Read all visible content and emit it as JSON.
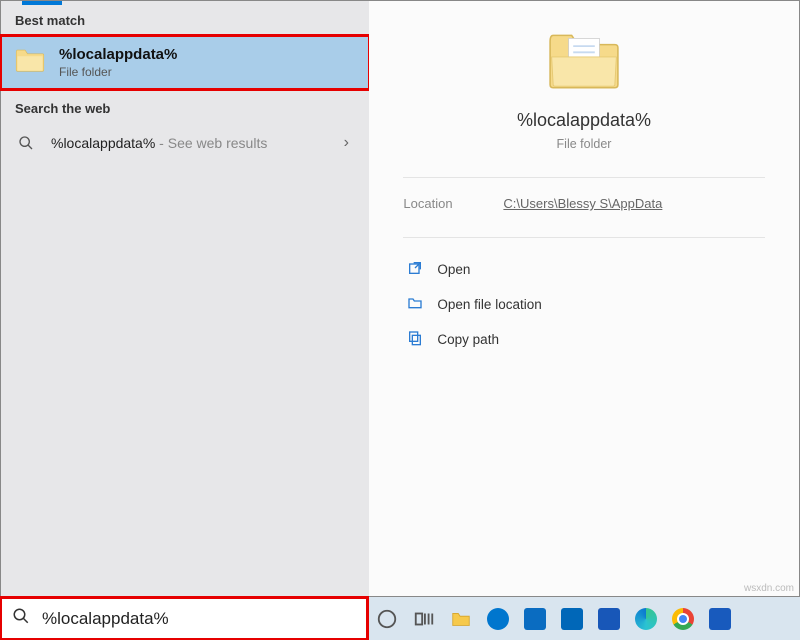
{
  "left": {
    "best_match_heading": "Best match",
    "best_match": {
      "title": "%localappdata%",
      "subtitle": "File folder"
    },
    "web_heading": "Search the web",
    "web_result": {
      "query": "%localappdata%",
      "suffix": " - See web results"
    }
  },
  "preview": {
    "title": "%localappdata%",
    "subtitle": "File folder",
    "location_label": "Location",
    "location_path": "C:\\Users\\Blessy S\\AppData",
    "actions": {
      "open": "Open",
      "open_location": "Open file location",
      "copy_path": "Copy path"
    }
  },
  "taskbar": {
    "search_value": "%localappdata%"
  },
  "watermark": "wsxdn.com"
}
